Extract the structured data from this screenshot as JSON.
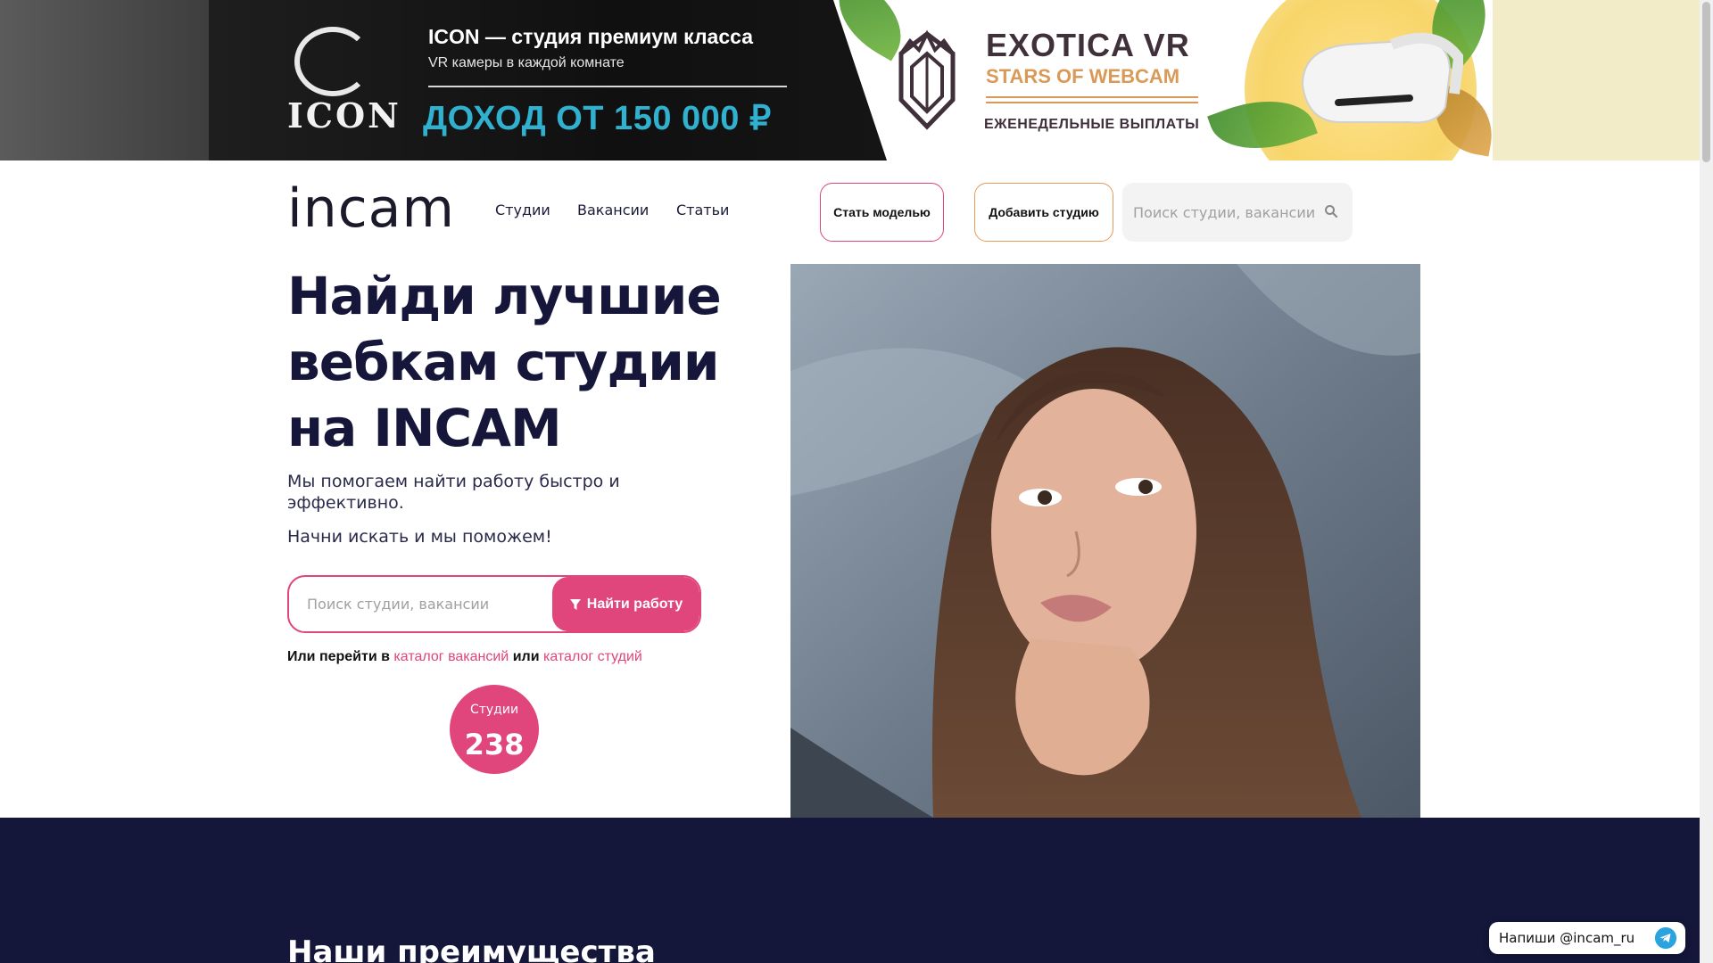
{
  "banner": {
    "icon_logo_text": "ICON",
    "icon_title": "ICON — студия премиум класса",
    "icon_subtitle": "VR камеры в каждой комнате",
    "icon_income": "ДОХОД ОТ 150 000 ₽",
    "exotica_title": "EXOTICA VR",
    "exotica_subtitle": "STARS OF WEBCAM",
    "exotica_payouts": "ЕЖЕНЕДЕЛЬНЫЕ ВЫПЛАТЫ"
  },
  "header": {
    "logo": "incam",
    "nav": [
      {
        "label": "Студии"
      },
      {
        "label": "Вакансии"
      },
      {
        "label": "Статьи"
      }
    ],
    "become_model": "Стать моделью",
    "add_studio": "Добавить студию",
    "search_placeholder": "Поиск студии, вакансии"
  },
  "hero": {
    "title": "Найди лучшие вебкам студии на INCAM",
    "subtitle1": "Мы помогаем найти работу быстро и эффективно.",
    "subtitle2": "Начни искать и мы поможем!",
    "search_placeholder": "Поиск студии, вакансии",
    "find_button": "Найти работу",
    "or_prefix": "Или перейти в",
    "vacancies_link": "каталог вакансий",
    "or_middle": "или",
    "studios_link": "каталог студий",
    "stat_label": "Студии",
    "stat_value": "238"
  },
  "advantages": {
    "title": "Наши преимущества"
  },
  "telegram": {
    "label": "Напиши @incam_ru"
  },
  "colors": {
    "accent": "#e0457b",
    "accent_secondary": "#e89a58",
    "dark_section": "#14163a",
    "text": "#16163a"
  },
  "icons": [
    "search-icon",
    "filter-icon",
    "telegram-icon",
    "vr-headset-icon",
    "crystal-logo-icon"
  ]
}
